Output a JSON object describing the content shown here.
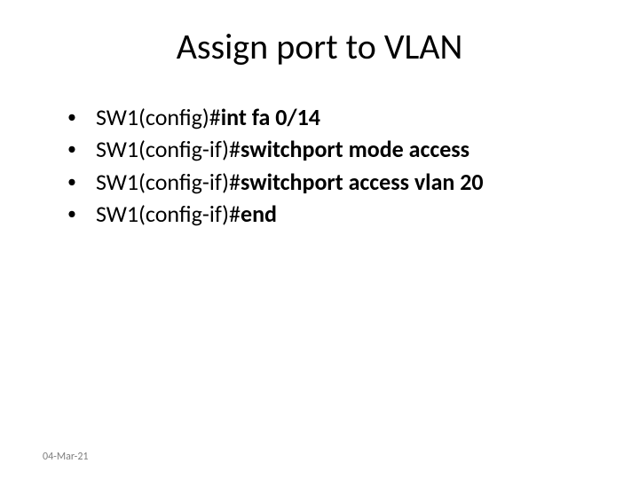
{
  "title": "Assign port to VLAN",
  "bullets": [
    {
      "prefix": "SW1(config)#",
      "command": "int fa 0/14"
    },
    {
      "prefix": "SW1(config-if)#",
      "command": "switchport mode access"
    },
    {
      "prefix": "SW1(config-if)#",
      "command": "switchport access vlan 20"
    },
    {
      "prefix": "SW1(config-if)#",
      "command": "end"
    }
  ],
  "footer_date": "04-Mar-21"
}
